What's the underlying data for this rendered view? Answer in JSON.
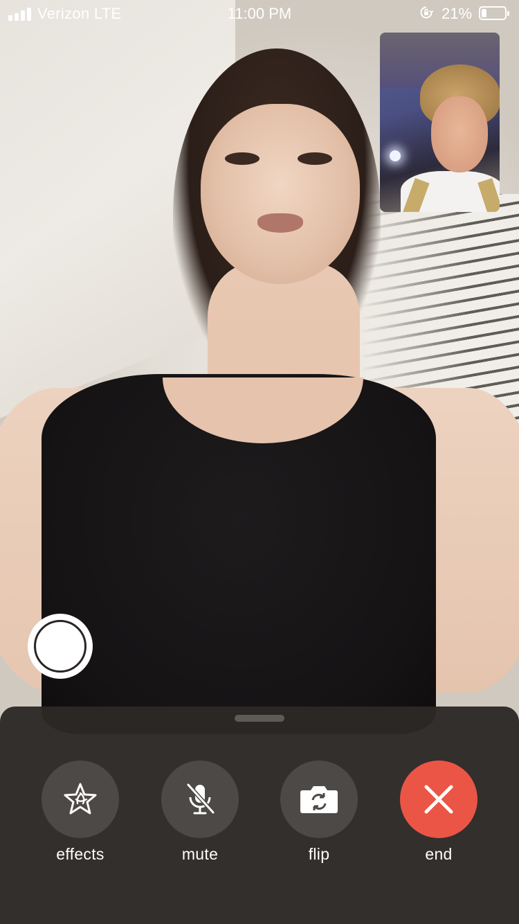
{
  "status_bar": {
    "carrier": "Verizon LTE",
    "time": "11:00 PM",
    "battery_percent": "21%",
    "battery_level": 0.21,
    "signal_bars": 4,
    "icons": [
      "signal-icon",
      "orientation-lock-icon",
      "battery-icon"
    ]
  },
  "call": {
    "remote_video": "remote-participant-video",
    "self_view": "self-view-video",
    "shutter": "live-photo-shutter"
  },
  "controls": {
    "effects": {
      "label": "effects",
      "icon": "effects-star-icon"
    },
    "mute": {
      "label": "mute",
      "icon": "microphone-slash-icon"
    },
    "flip": {
      "label": "flip",
      "icon": "camera-flip-icon"
    },
    "end": {
      "label": "end",
      "icon": "close-x-icon"
    }
  },
  "colors": {
    "panel_background": "#2c2927",
    "button_background": "#4d4946",
    "end_button": "#eb5545",
    "text": "#ffffff"
  }
}
